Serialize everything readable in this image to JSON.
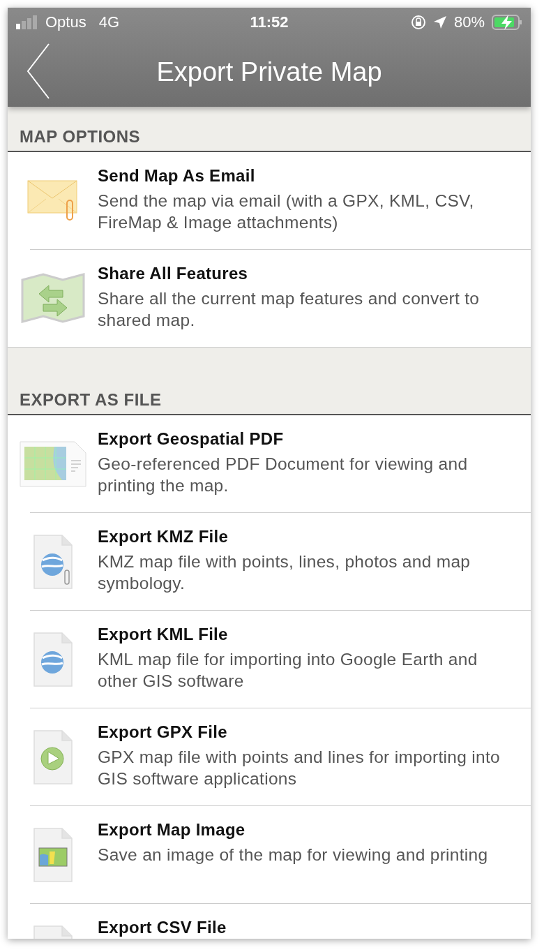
{
  "status_bar": {
    "carrier": "Optus",
    "network": "4G",
    "time": "11:52",
    "battery": "80%"
  },
  "nav": {
    "title": "Export Private Map"
  },
  "sections": [
    {
      "header": "MAP OPTIONS",
      "items": [
        {
          "kind": "envelope",
          "title": "Send Map As Email",
          "description": "Send the map via email (with a GPX, KML, CSV, FireMap & Image attachments)"
        },
        {
          "kind": "share",
          "title": "Share All Features",
          "description": "Share all the current map features and convert to shared map."
        }
      ]
    },
    {
      "header": "EXPORT AS FILE",
      "items": [
        {
          "kind": "pdf",
          "title": "Export Geospatial PDF",
          "description": "Geo-referenced PDF Document for viewing and printing the map."
        },
        {
          "kind": "kmz",
          "title": "Export KMZ File",
          "description": "KMZ map file with points, lines, photos and map symbology."
        },
        {
          "kind": "kml",
          "title": "Export KML File",
          "description": "KML map file for importing into Google Earth and other GIS software"
        },
        {
          "kind": "gpx",
          "title": "Export GPX File",
          "description": "GPX map file with points and lines for importing into GIS software applications"
        },
        {
          "kind": "image",
          "title": "Export Map Image",
          "description": "Save an image of the map for viewing and printing"
        },
        {
          "kind": "csv",
          "title": "Export CSV File"
        }
      ]
    }
  ]
}
